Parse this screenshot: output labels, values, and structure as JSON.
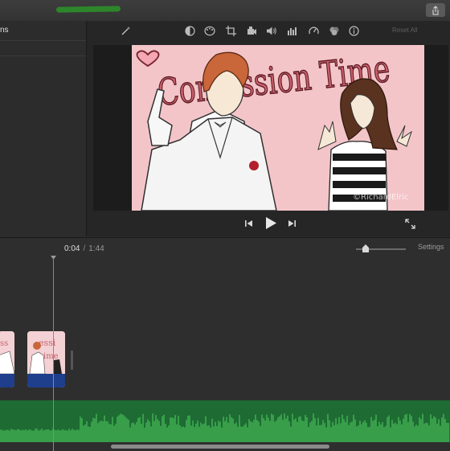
{
  "titlebar": {
    "title_scribble": "",
    "share_icon": "share-icon"
  },
  "browser": {
    "tab_label": "ns"
  },
  "viewer": {
    "toolbar_icons": [
      "magic-wand-icon",
      "color-balance-icon",
      "palette-icon",
      "crop-icon",
      "camera-icon",
      "volume-icon",
      "equalizer-icon",
      "speed-icon",
      "filter-icon",
      "info-icon"
    ],
    "reset_all": "Reset All",
    "preview": {
      "title_text": "Confession Time",
      "watermark": "©RichardElric"
    },
    "playback": [
      "skip-back-icon",
      "play-icon",
      "skip-forward-icon"
    ],
    "fullscreen_icon": "expand-icon"
  },
  "timeline": {
    "current_time": "0:04",
    "separator": "/",
    "duration": "1:44",
    "settings_label": "Settings",
    "zoom_level": 0.2,
    "colors": {
      "audio": "#1e6b33",
      "waveform": "#49c15a",
      "clip_bottom": "#1f3e8c"
    }
  }
}
